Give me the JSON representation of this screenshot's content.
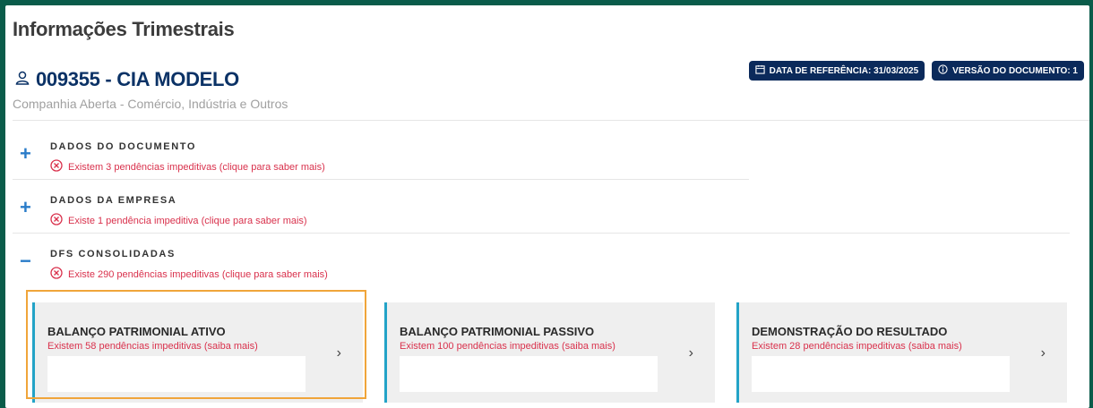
{
  "page": {
    "title": "Informações Trimestrais"
  },
  "company": {
    "name": "009355 - CIA MODELO",
    "subtitle": "Companhia Aberta - Comércio, Indústria e Outros",
    "icon": "user-icon"
  },
  "badges": [
    {
      "label": "DATA DE REFERÊNCIA: 31/03/2025",
      "icon": "calendar-icon"
    },
    {
      "label": "VERSÃO DO DOCUMENTO: 1",
      "icon": "info-icon"
    }
  ],
  "sections": [
    {
      "title": "DADOS DO DOCUMENTO",
      "toggle": "+",
      "message": "Existem 3 pendências impeditivas (clique para saber mais)"
    },
    {
      "title": "DADOS DA EMPRESA",
      "toggle": "+",
      "message": "Existe 1 pendência impeditiva (clique para saber mais)"
    },
    {
      "title": "DFS CONSOLIDADAS",
      "toggle": "−",
      "message": "Existe 290 pendências impeditivas (clique para saber mais)"
    }
  ],
  "cards": [
    {
      "title": "BALANÇO PATRIMONIAL ATIVO",
      "message": "Existem 58 pendências impeditivas (saiba mais)",
      "chevron": "›"
    },
    {
      "title": "BALANÇO PATRIMONIAL PASSIVO",
      "message": "Existem 100 pendências impeditivas (saiba mais)",
      "chevron": "›"
    },
    {
      "title": "DEMONSTRAÇÃO DO RESULTADO",
      "message": "Existem 28 pendências impeditivas (saiba mais)",
      "chevron": "›"
    }
  ],
  "colors": {
    "background": "#0a5c4a",
    "accent": "#2a7cc9",
    "error": "#d9314c",
    "badge": "#0b2a5b",
    "card_border": "#23a3c7",
    "highlight": "#f0a53a"
  }
}
